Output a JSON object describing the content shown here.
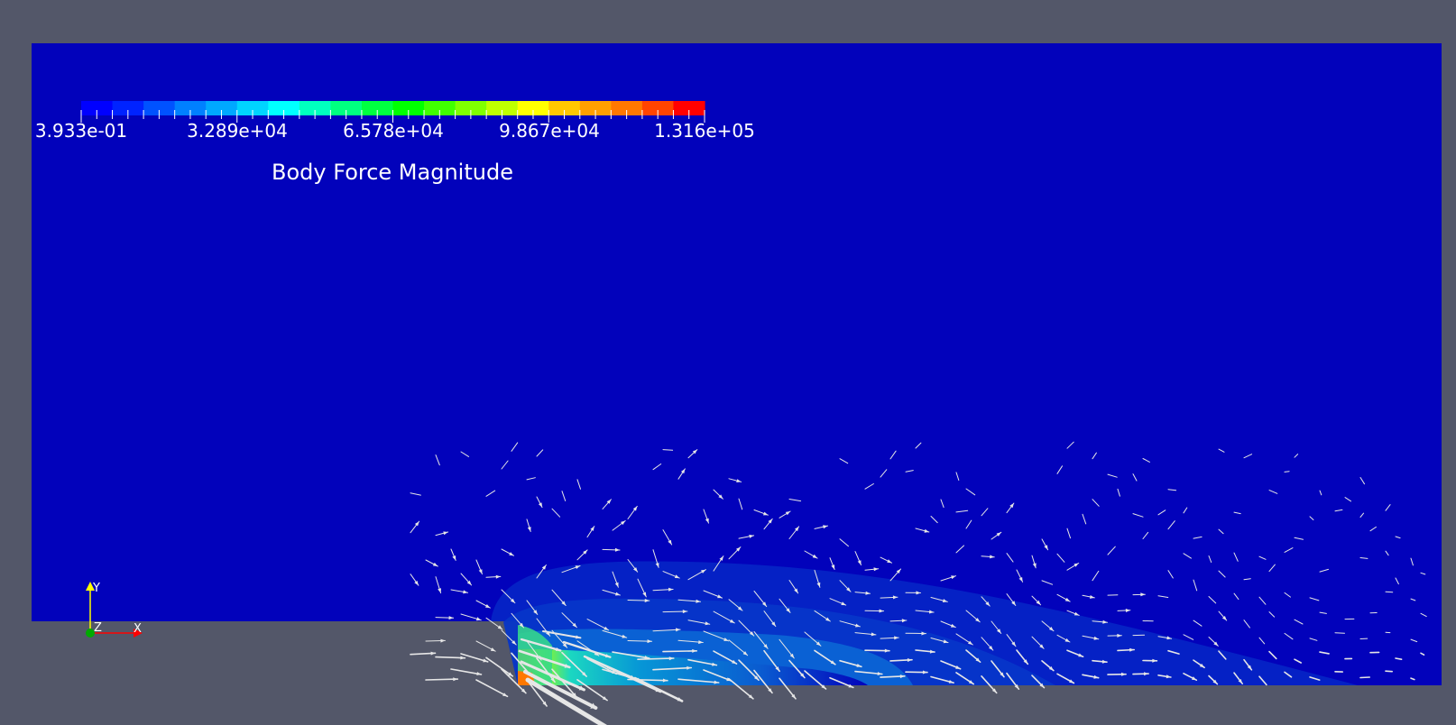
{
  "colormap": {
    "title": "Body Force Magnitude",
    "range": [
      0.3933,
      131600
    ],
    "tick_labels": [
      "3.933e-01",
      "3.289e+04",
      "6.578e+04",
      "9.867e+04",
      "1.316e+05"
    ],
    "colors": [
      "#0000ff",
      "#0023ff",
      "#0052ff",
      "#0080ff",
      "#00a8ff",
      "#00d4ff",
      "#00ffff",
      "#00ffbf",
      "#00ff80",
      "#00ff40",
      "#00ff00",
      "#40ff00",
      "#80ff00",
      "#bfff00",
      "#ffff00",
      "#ffc800",
      "#ffa000",
      "#ff7800",
      "#ff4400",
      "#ff0000"
    ]
  },
  "axes": {
    "x": "X",
    "y": "Y",
    "z": "Z",
    "colors": {
      "x": "#ff0000",
      "y": "#ffff00",
      "z": "#00aa00"
    }
  },
  "colors": {
    "background": "#535769",
    "domain": "#0202bb",
    "arrow": "#e6e6e6"
  }
}
